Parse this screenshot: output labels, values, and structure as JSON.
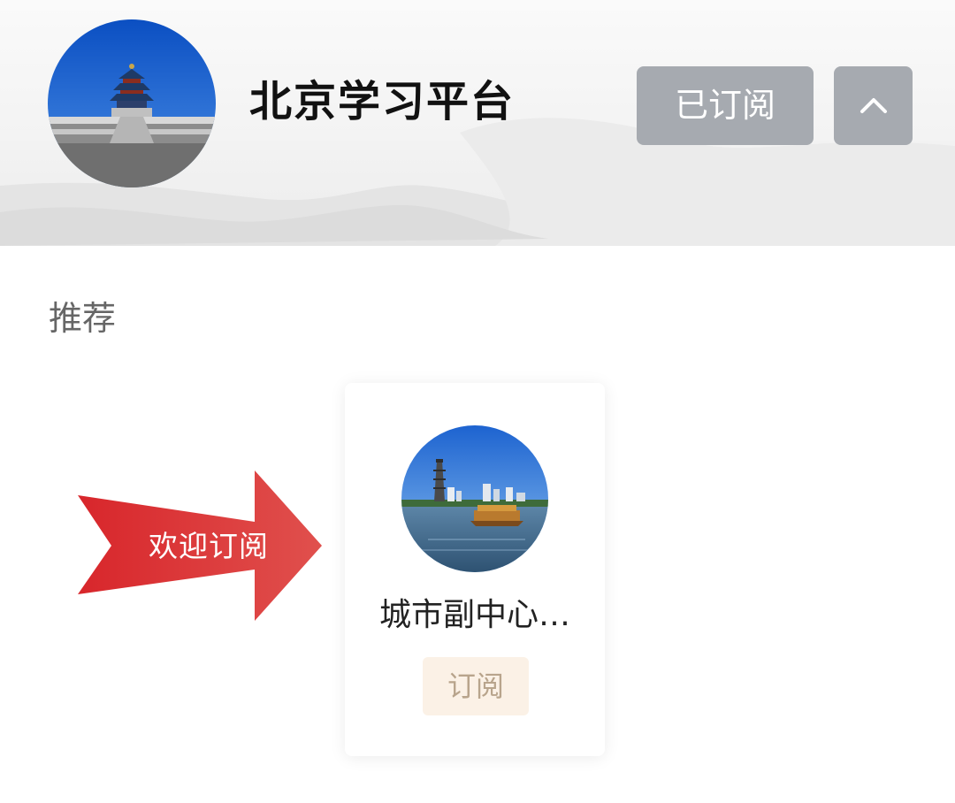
{
  "header": {
    "title": "北京学习平台",
    "subscribed_label": "已订阅",
    "collapse_icon": "chevron-up-icon"
  },
  "recommend": {
    "section_label": "推荐",
    "banner_text": "欢迎订阅",
    "cards": [
      {
        "name": "城市副中心…",
        "subscribe_label": "订阅"
      }
    ]
  },
  "colors": {
    "button_gray": "#a6aab0",
    "arrow_red": "#d7363a",
    "subscribe_bg": "#fbf1e6",
    "subscribe_text": "#b8a48c"
  }
}
